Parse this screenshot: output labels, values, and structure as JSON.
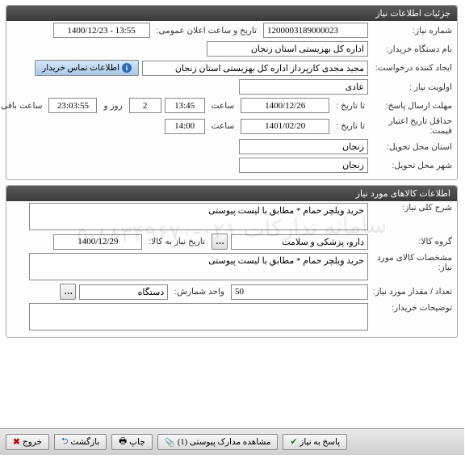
{
  "panel1": {
    "title": "جزئیات اطلاعات نیاز",
    "need_no_label": "شماره نیاز:",
    "need_no": "1200003189000023",
    "pub_date_label": "تاریخ و ساعت اعلان عمومی:",
    "pub_date": "1400/12/23 - 13:55",
    "buyer_label": "نام دستگاه خریدار:",
    "buyer": "اداره کل بهزیستی استان زنجان",
    "creator_label": "ایجاد کننده درخواست:",
    "creator": "مجید مجدی کارپرداز اداره کل بهزیستی استان زنجان",
    "contact_btn": "اطلاعات تماس خریدار",
    "priority_label": "اولویت نیاز :",
    "priority": "عادی",
    "deadline_label": "مهلت ارسال پاسخ:",
    "to_date_label": "تا تاریخ :",
    "to_date1": "1400/12/26",
    "time_label": "ساعت",
    "time1": "13:45",
    "days": "2",
    "days_label": "روز و",
    "remain_time": "23:03:55",
    "remain_label": "ساعت باقی مانده",
    "min_valid_label": "حداقل تاریخ اعتبار قیمت:",
    "to_date2": "1401/02/20",
    "time2": "14:00",
    "province_label": "استان محل تحویل:",
    "province": "زنجان",
    "city_label": "شهر محل تحویل:",
    "city": "زنجان"
  },
  "panel2": {
    "title": "اطلاعات کالاهای مورد نیاز",
    "desc_label": "شرح کلی نیاز:",
    "desc": "خرید ویلچر حمام * مطابق با لیست پیوستی",
    "group_label": "گروه کالا:",
    "group": "دارو، پزشکی و سلامت",
    "need_date_label": "تاریخ نیاز به کالا:",
    "need_date": "1400/12/29",
    "spec_label": "مشخصات کالای مورد نیاز:",
    "spec": "خرید ویلچر حمام * مطابق با لیست پیوستی",
    "qty_label": "تعداد / مقدار مورد نیاز:",
    "qty": "50",
    "unit_label": "واحد شمارش:",
    "unit": "دستگاه",
    "buyer_note_label": "توضیحات خریدار:"
  },
  "footer": {
    "exit": "خروج",
    "back": "بازگشت",
    "print": "چاپ",
    "attach": "مشاهده مدارک پیوستی (1)",
    "reply": "پاسخ به نیاز"
  },
  "watermark": "سامانه تدارکات ۰۲۱-۸۸۳۴۹۶۷۰-۵"
}
